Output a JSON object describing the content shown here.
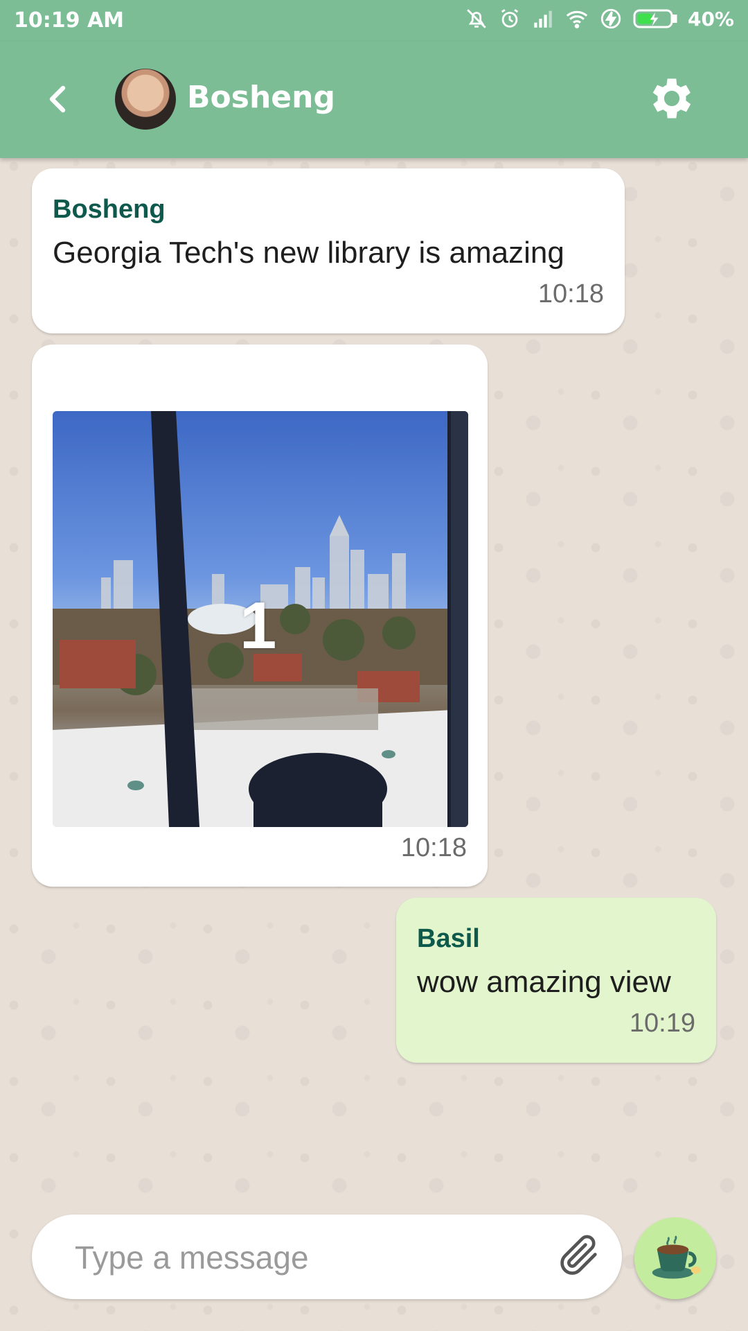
{
  "status_bar": {
    "time": "10:19 AM",
    "battery_percent": "40%",
    "icons": [
      "mute-icon",
      "alarm-icon",
      "signal-icon",
      "wifi-icon",
      "flash-icon",
      "battery-icon"
    ]
  },
  "header": {
    "back_icon": "chevron-left-icon",
    "contact_name": "Bosheng",
    "settings_icon": "gear-icon"
  },
  "messages": [
    {
      "direction": "incoming",
      "sender": "Bosheng",
      "text": "Georgia Tech's new library is amazing",
      "time": "10:18"
    },
    {
      "direction": "incoming",
      "type": "image",
      "image_overlay_text": "1",
      "time": "10:18"
    },
    {
      "direction": "outgoing",
      "sender": "Basil",
      "text": "wow amazing view",
      "time": "10:19"
    }
  ],
  "composer": {
    "value": "",
    "placeholder": "Type a message",
    "attach_icon": "paperclip-icon",
    "send_icon": "coffee-cup-icon"
  },
  "colors": {
    "app_bar": "#7cbd96",
    "sender_name": "#0d5a4d",
    "outgoing_bubble": "#e2f5cd",
    "incoming_bubble": "#ffffff",
    "send_button": "#c4ec9e"
  }
}
